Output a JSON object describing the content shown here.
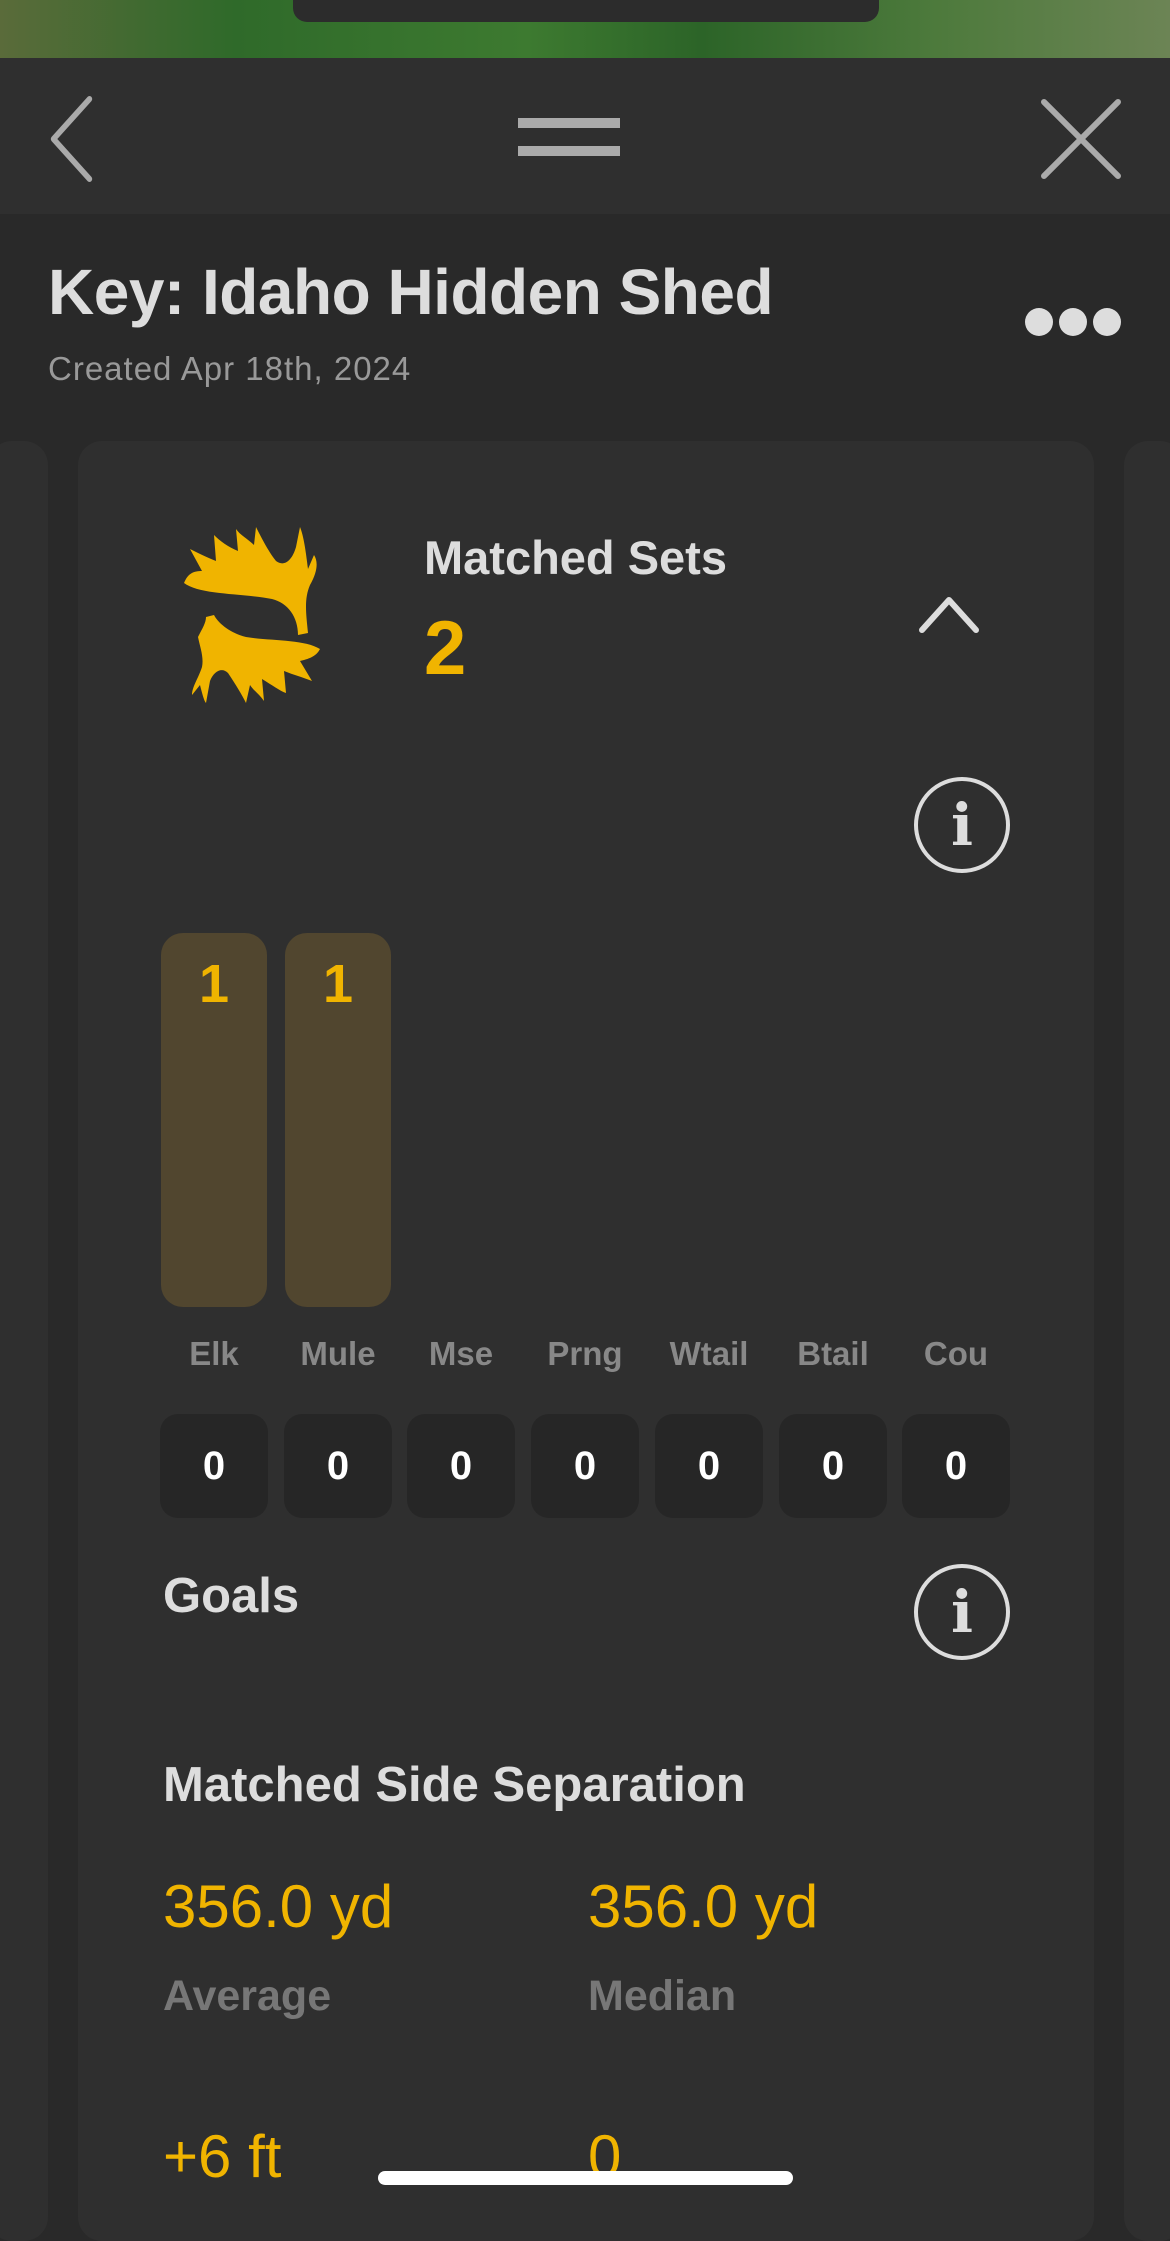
{
  "nav": {
    "back_icon": "chevron-left-icon",
    "handle_icon": "drag-handle-icon",
    "close_icon": "close-icon"
  },
  "header": {
    "title": "Key: Idaho Hidden Shed",
    "subtitle": "Created Apr 18th, 2024",
    "more_icon": "ellipsis-icon"
  },
  "matched_sets": {
    "label": "Matched Sets",
    "count": "2",
    "icon": "antler-pair-icon",
    "collapse_icon": "chevron-up-icon",
    "accent": "#f0b400",
    "species": [
      {
        "name": "Elk",
        "bar_value": 1,
        "count": "0"
      },
      {
        "name": "Mule",
        "bar_value": 1,
        "count": "0"
      },
      {
        "name": "Mse",
        "bar_value": 0,
        "count": "0"
      },
      {
        "name": "Prng",
        "bar_value": 0,
        "count": "0"
      },
      {
        "name": "Wtail",
        "bar_value": 0,
        "count": "0"
      },
      {
        "name": "Btail",
        "bar_value": 0,
        "count": "0"
      },
      {
        "name": "Cou",
        "bar_value": 0,
        "count": "0"
      }
    ]
  },
  "goals": {
    "label": "Goals"
  },
  "separation": {
    "title": "Matched Side Separation",
    "average_value": "356.0 yd",
    "average_label": "Average",
    "median_value": "356.0 yd",
    "median_label": "Median",
    "row2_left": "+6 ft",
    "row2_right": "0"
  }
}
